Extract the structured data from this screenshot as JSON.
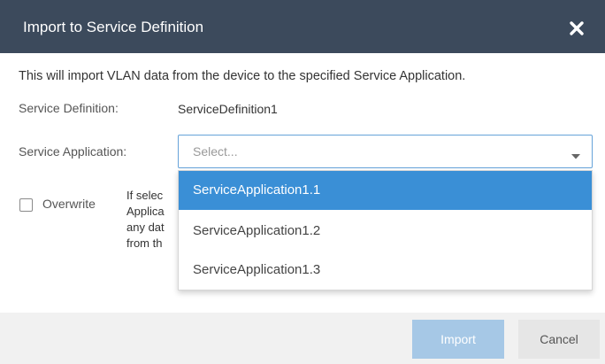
{
  "dialog": {
    "title": "Import to Service Definition",
    "close_icon": "close-icon",
    "description": "This will import VLAN data from the device to the specified Service Application.",
    "service_definition_label": "Service Definition:",
    "service_definition_value": "ServiceDefinition1",
    "service_application_label": "Service Application:",
    "service_application_placeholder": "Select...",
    "overwrite_label": "Overwrite",
    "overwrite_checked": false,
    "help_text_lines": [
      "If selec",
      "Applica",
      "any dat",
      "from th"
    ],
    "dropdown_options": [
      "ServiceApplication1.1",
      "ServiceApplication1.2",
      "ServiceApplication1.3"
    ],
    "highlighted_option_index": 0,
    "import_label": "Import",
    "cancel_label": "Cancel"
  },
  "colors": {
    "titlebar": "#3c4a5c",
    "highlight": "#3a8fd6",
    "import_button": "#a6c8e6",
    "footer": "#f1f1f1"
  }
}
